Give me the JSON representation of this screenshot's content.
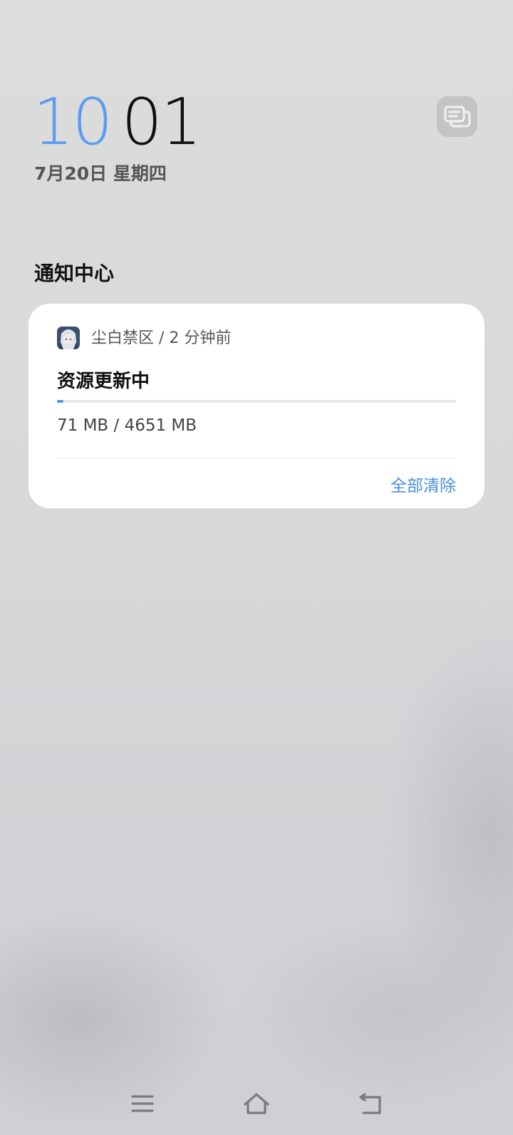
{
  "lockscreen": {
    "time_hours": "10",
    "time_minutes": "01",
    "date": "7月20日 星期四",
    "accent_color": "#5b9cf0"
  },
  "message_button": {
    "icon": "message-cards-icon"
  },
  "notification_center": {
    "title": "通知中心"
  },
  "notification": {
    "app_name": "尘白禁区",
    "separator": " / ",
    "time": "2 分钟前",
    "app_icon": "game-avatar-icon",
    "title": "资源更新中",
    "progress_fraction": 0.0153,
    "size_text": "71 MB / 4651 MB",
    "progress_color": "#4f95ee"
  },
  "actions": {
    "clear_all": "全部清除"
  },
  "navbar": {
    "icons": [
      "menu-icon",
      "home-icon",
      "back-icon"
    ]
  }
}
